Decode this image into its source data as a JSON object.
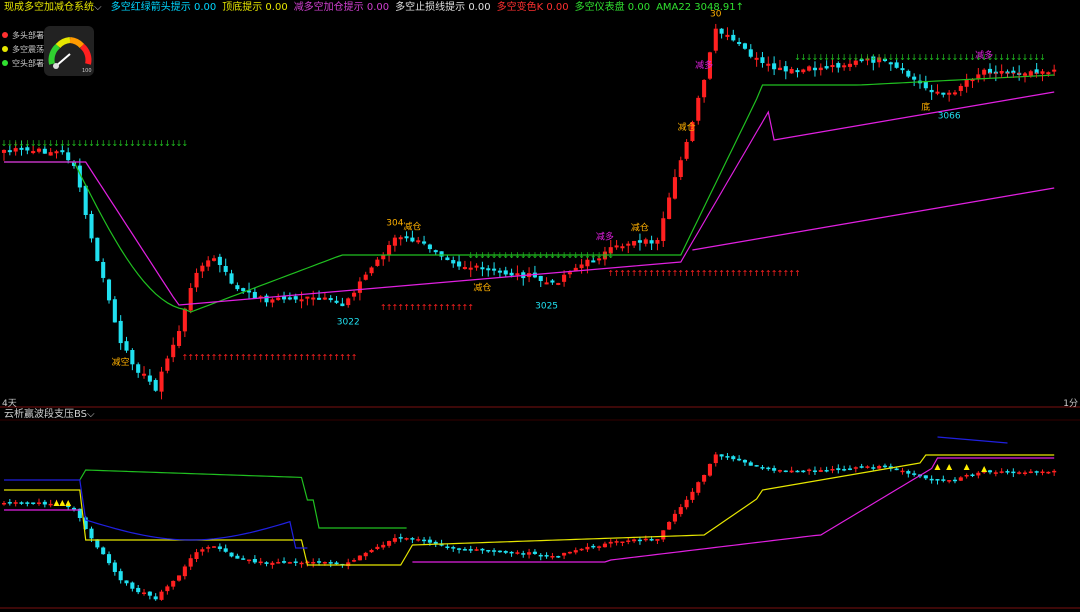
{
  "header": {
    "title": "现成多空加减仓系统",
    "indicators": [
      {
        "label": "多空红绿箭头提示",
        "value": "0.00",
        "color": "#00d7ff"
      },
      {
        "label": "顶底提示",
        "value": "0.00",
        "color": "#e6e600"
      },
      {
        "label": "减多空加仓提示",
        "value": "0.00",
        "color": "#d040d0"
      },
      {
        "label": "多空止损线提示",
        "value": "0.00",
        "color": "#e0e0e0"
      },
      {
        "label": "多空变色K",
        "value": "0.00",
        "color": "#ff3030"
      },
      {
        "label": "多空仪表盘",
        "value": "0.00",
        "color": "#30e030"
      },
      {
        "label": "AMA22",
        "value": "3048.91↑",
        "color": "#30e030"
      }
    ]
  },
  "legend": [
    {
      "label": "多头部署",
      "color": "#ff3030"
    },
    {
      "label": "多空震荡",
      "color": "#e6e600"
    },
    {
      "label": "空头部署",
      "color": "#30e030"
    }
  ],
  "gauge": {
    "icon": "gauge-icon",
    "label": "100"
  },
  "period_left": "4天",
  "period_right": "1分",
  "sub_title": "云析赢波段支压BS",
  "colors": {
    "up": "#ff2020",
    "down": "#20e0f0",
    "green_line": "#20c020",
    "magenta_line": "#e020e0",
    "yellow_line": "#e6e600",
    "blue_line": "#2020e0"
  },
  "chart_data": [
    {
      "type": "candlestick",
      "price_labels": [
        {
          "text": "3022",
          "index": 59
        },
        {
          "text": "3025",
          "index": 93
        },
        {
          "text": "3066",
          "index": 162
        }
      ],
      "annotations": [
        {
          "text": "减空",
          "index": 20,
          "pos": "below"
        },
        {
          "text": "304",
          "index": 67,
          "pos": "above"
        },
        {
          "text": "减仓",
          "index": 70,
          "pos": "above"
        },
        {
          "text": "减仓",
          "index": 82,
          "pos": "below"
        },
        {
          "text": "减多",
          "index": 103,
          "pos": "above"
        },
        {
          "text": "减仓",
          "index": 109,
          "pos": "above"
        },
        {
          "text": "减仓",
          "index": 117,
          "pos": "above"
        },
        {
          "text": "30",
          "index": 122,
          "pos": "above"
        },
        {
          "text": "减多",
          "index": 120,
          "pos": "above"
        },
        {
          "text": "减多",
          "index": 168,
          "pos": "above"
        },
        {
          "text": "底",
          "index": 158,
          "pos": "below"
        }
      ]
    },
    {
      "type": "line",
      "series": [
        {
          "color": "green"
        },
        {
          "color": "yellow"
        },
        {
          "color": "blue"
        },
        {
          "color": "magenta"
        }
      ]
    }
  ]
}
